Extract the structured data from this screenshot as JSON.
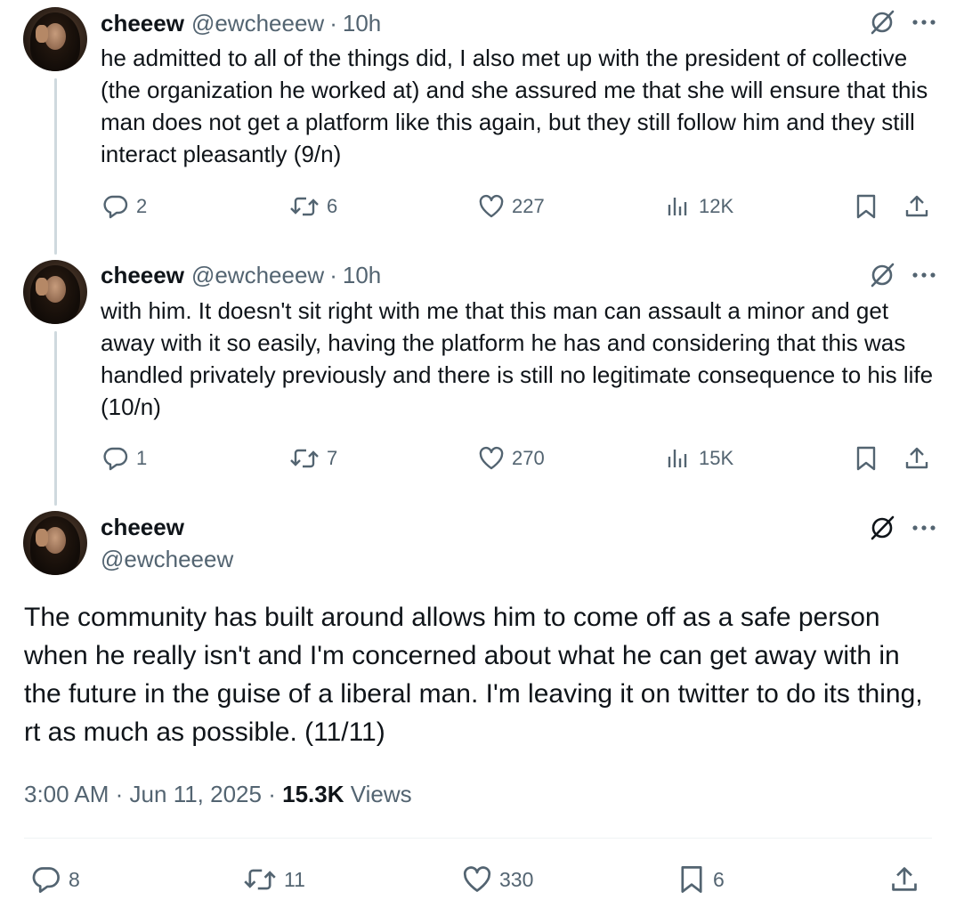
{
  "tweets": [
    {
      "name": "cheeew",
      "handle": "@ewcheeew",
      "separator": "·",
      "time": "10h",
      "text": "he admitted to all of the things did, I also met up with the president of collective (the organization he worked at) and she assured me that she will ensure that this man does not get a platform like this again, but they still follow him and they still interact pleasantly (9/n)",
      "replies": "2",
      "retweets": "6",
      "likes": "227",
      "views": "12K"
    },
    {
      "name": "cheeew",
      "handle": "@ewcheeew",
      "separator": "·",
      "time": "10h",
      "text": "with him. It doesn't sit right with me that this man can assault a minor and get away with it so easily, having the platform he has and considering that this was handled privately previously and there is still no legitimate consequence to his life (10/n)",
      "replies": "1",
      "retweets": "7",
      "likes": "270",
      "views": "15K"
    }
  ],
  "main": {
    "name": "cheeew",
    "handle": "@ewcheeew",
    "text": "The community has built around allows him to come off as a safe person when he really isn't and I'm concerned about what he can get away with in the future in the guise of a liberal man. I'm leaving it on twitter to do its thing, rt as much as possible. (11/11)",
    "time": "3:00 AM",
    "separator": "·",
    "date": "Jun 11, 2025",
    "views_count": "15.3K",
    "views_label": "Views",
    "replies": "8",
    "retweets": "11",
    "likes": "330",
    "bookmarks": "6"
  },
  "icons": {
    "grok": "grok-slash-circle-icon",
    "more": "more-dots-icon",
    "reply": "reply-bubble-icon",
    "retweet": "retweet-arrows-icon",
    "like": "heart-icon",
    "views": "views-bars-icon",
    "bookmark": "bookmark-icon",
    "share": "share-upload-icon"
  },
  "colors": {
    "text": "#0f1419",
    "secondary": "#536471",
    "thread_line": "#cfd9de",
    "divider": "#eff3f4"
  }
}
